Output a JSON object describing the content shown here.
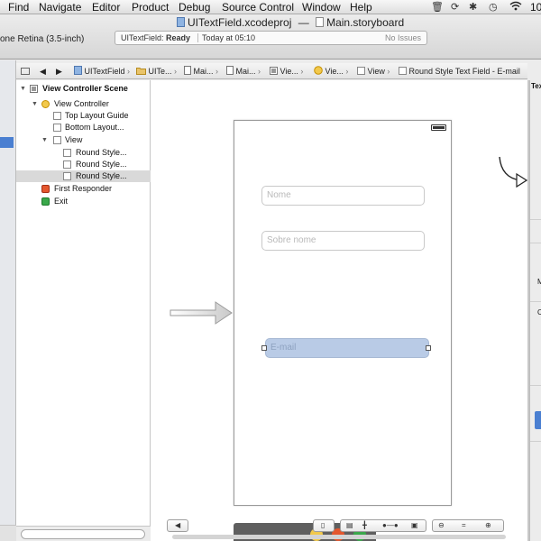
{
  "menubar": {
    "items": [
      "Find",
      "Navigate",
      "Editor",
      "Product",
      "Debug",
      "Source Control",
      "Window",
      "Help"
    ],
    "clock": "10"
  },
  "window": {
    "project_title": "UITextField.xcodeproj",
    "title_separator": "—",
    "storyboard_title": "Main.storyboard",
    "scheme": "one Retina (3.5-inch)"
  },
  "activity": {
    "project": "UITextField:",
    "status": "Ready",
    "time": "Today at 05:10",
    "issues": "No Issues"
  },
  "jumpbar": {
    "crumbs": [
      "UITextField",
      "UITe...",
      "Mai...",
      "Mai...",
      "Vie...",
      "Vie...",
      "View",
      "Round Style Text Field - E-mail"
    ]
  },
  "outline": {
    "scene": "View Controller Scene",
    "view_controller": "View Controller",
    "top_guide": "Top Layout Guide",
    "bottom_guide": "Bottom Layout...",
    "view": "View",
    "round1": "Round Style...",
    "round2": "Round Style...",
    "round3": "Round Style...",
    "first_responder": "First Responder",
    "exit": "Exit"
  },
  "phone": {
    "fields": {
      "nome_placeholder": "Nome",
      "sobre_placeholder": "Sobre nome",
      "email_placeholder": "E-mail"
    }
  },
  "utilities": {
    "inspector_tab": "Tex",
    "label_m": "M",
    "label_c": "C"
  },
  "colors": {
    "selection_blue": "#b9cbe6",
    "accent_blue": "#4a7fd1"
  }
}
